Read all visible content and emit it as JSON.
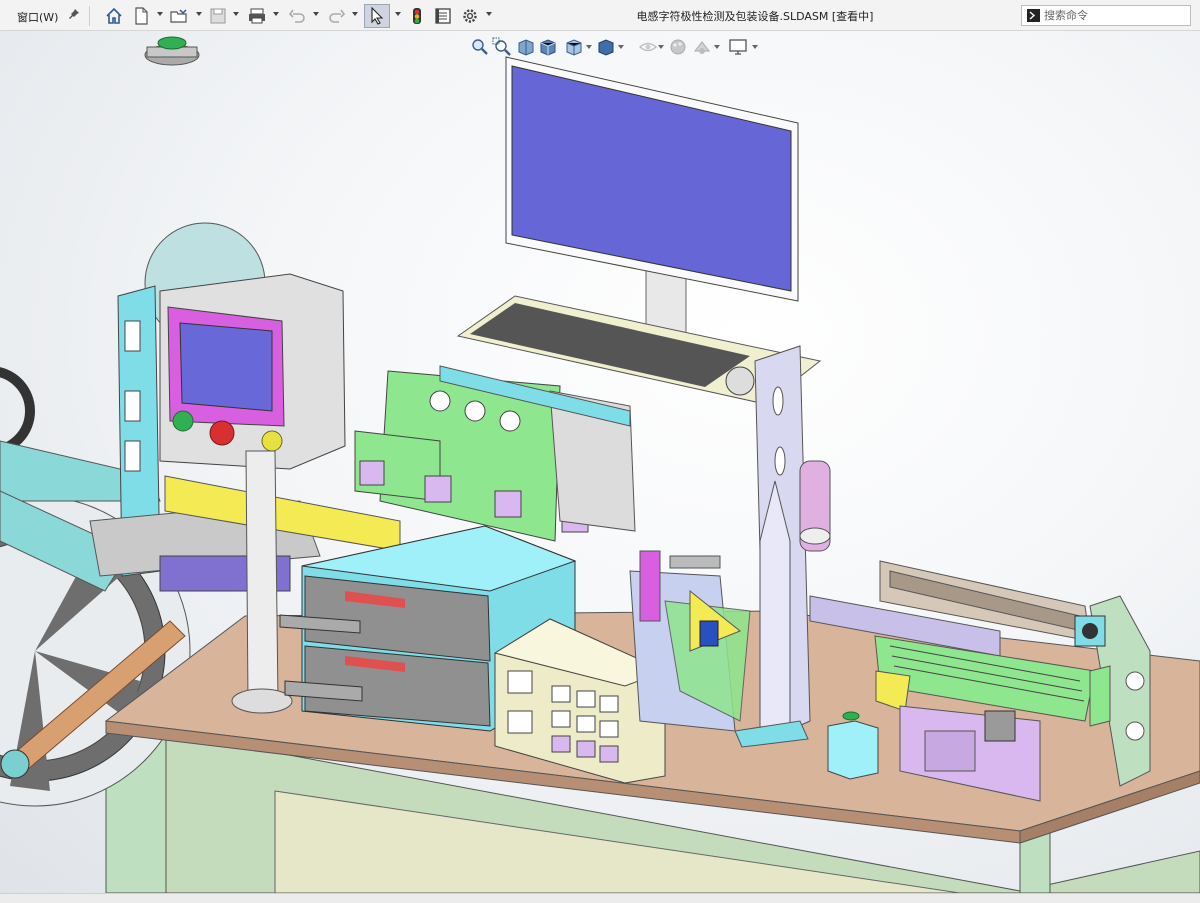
{
  "menu": {
    "window_label": "窗口(W)"
  },
  "toolbar": {
    "icons": [
      "home-icon",
      "new-document-icon",
      "open-folder-icon",
      "save-icon",
      "print-icon",
      "undo-icon",
      "redo-icon",
      "select-cursor-icon",
      "traffic-light-icon",
      "file-properties-icon",
      "options-gear-icon"
    ]
  },
  "document": {
    "title": "电感字符极性检测及包装设备.SLDASM [查看中]"
  },
  "search": {
    "placeholder": "搜索命令"
  },
  "heads_up_toolbar": {
    "icons": [
      "zoom-to-fit-icon",
      "zoom-area-icon",
      "previous-view-icon",
      "section-view-icon",
      "view-orientation-icon",
      "display-style-icon",
      "hide-show-icon",
      "edit-appearance-icon",
      "apply-scene-icon",
      "view-settings-icon"
    ]
  },
  "colors": {
    "monitor_screen": "#6666d6",
    "hmi_screen": "#6868d8",
    "hmi_bezel": "#d860e0",
    "table_top": "#d7b49a",
    "table_frame": "#c8e0c0",
    "cabinet_cyan": "#7fdde8",
    "green_plate": "#8ee68e",
    "lavender": "#d8b8ee",
    "yellow": "#f4ea54"
  }
}
